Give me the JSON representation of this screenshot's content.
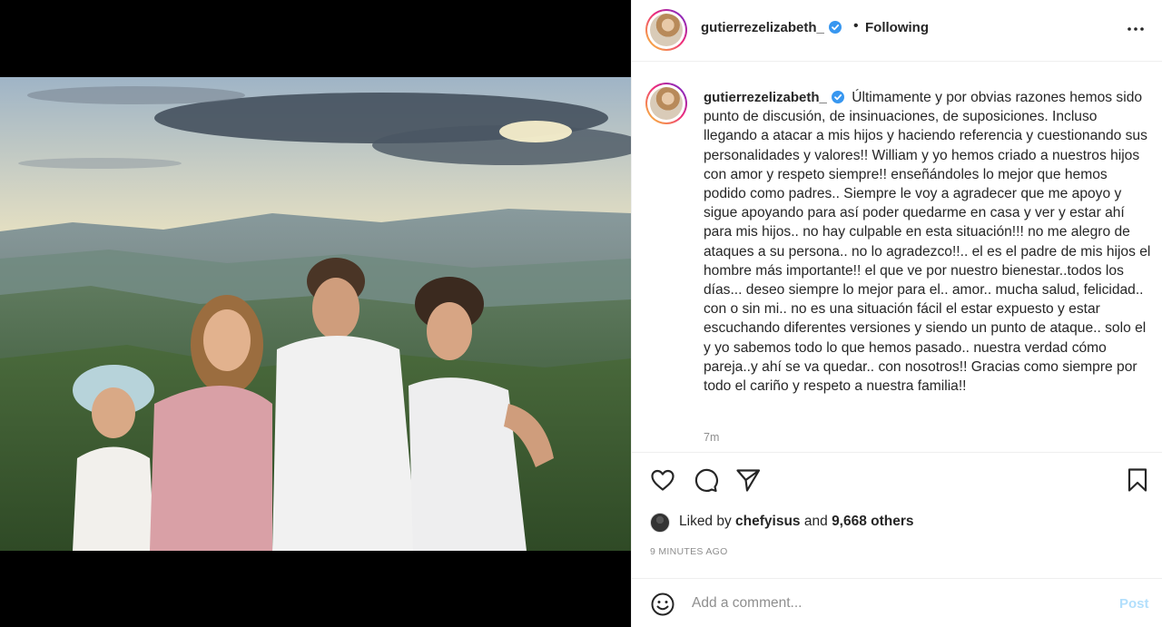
{
  "post": {
    "username": "gutierrezelizabeth_",
    "follow_status": "Following",
    "separator": "•",
    "more_icon": "more-horizontal-icon",
    "verified_color": "#3897f0"
  },
  "caption": {
    "username": "gutierrezelizabeth_",
    "text": "Últimamente y por obvias razones hemos sido punto de discusión, de insinuaciones, de suposiciones. Incluso llegando a atacar a mis hijos y haciendo referencia y cuestionando sus personalidades y valores!! William y yo hemos criado a nuestros hijos con amor y respeto siempre!! enseñándoles lo mejor que hemos podido como padres.. Siempre le voy a agradecer que me apoyo y sigue apoyando para así poder quedarme en casa y ver y estar ahí para mis hijos.. no hay culpable en esta situación!!! no me alegro de ataques a su persona.. no lo agradezco!!.. el es el padre de mis hijos el hombre más importante!! el que ve por nuestro bienestar..todos los días... deseo siempre lo mejor para el.. amor.. mucha salud, felicidad.. con o sin mi.. no es una situación fácil el estar expuesto y estar escuchando diferentes versiones y siendo un punto de ataque.. solo el y yo sabemos todo lo que hemos pasado.. nuestra verdad cómo pareja..y ahí se va quedar.. con nosotros!! Gracias como siempre por todo el cariño y respeto a nuestra familia!!",
    "time_ago": "7m"
  },
  "actions": {
    "like_icon": "heart-icon",
    "comment_icon": "comment-icon",
    "share_icon": "paper-plane-icon",
    "save_icon": "bookmark-icon"
  },
  "likes": {
    "prefix": "Liked by",
    "user": "chefyisus",
    "conjunction": "and",
    "others": "9,668 others"
  },
  "timestamp": "9 MINUTES AGO",
  "add_comment": {
    "placeholder": "Add a comment...",
    "post_label": "Post",
    "post_color": "#b2dffc",
    "emoji_icon": "smiley-icon"
  }
}
